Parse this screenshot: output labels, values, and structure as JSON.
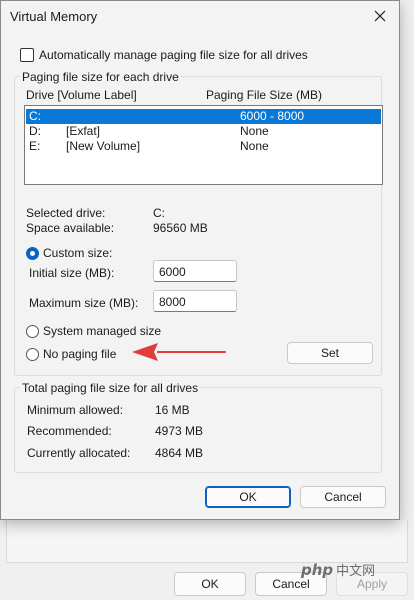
{
  "dialog": {
    "title": "Virtual Memory",
    "auto_manage_label": "Automatically manage paging file size for all drives",
    "auto_manage_checked": false,
    "group_each_drive": "Paging file size for each drive",
    "columns": {
      "drive": "Drive  [Volume Label]",
      "size": "Paging File Size (MB)"
    },
    "drives": [
      {
        "letter": "C:",
        "label": "",
        "size": "6000 - 8000",
        "selected": true
      },
      {
        "letter": "D:",
        "label": "[Exfat]",
        "size": "None",
        "selected": false
      },
      {
        "letter": "E:",
        "label": "[New Volume]",
        "size": "None",
        "selected": false
      }
    ],
    "selected_drive_label": "Selected drive:",
    "selected_drive_value": "C:",
    "space_available_label": "Space available:",
    "space_available_value": "96560 MB",
    "custom_size_label": "Custom size:",
    "initial_size_label": "Initial size (MB):",
    "initial_size_value": "6000",
    "maximum_size_label": "Maximum size (MB):",
    "maximum_size_value": "8000",
    "system_managed_label": "System managed size",
    "no_paging_label": "No paging file",
    "selected_option": "custom",
    "set_label": "Set",
    "group_total": "Total paging file size for all drives",
    "minimum_label": "Minimum allowed:",
    "minimum_value": "16 MB",
    "recommended_label": "Recommended:",
    "recommended_value": "4973 MB",
    "allocated_label": "Currently allocated:",
    "allocated_value": "4864 MB",
    "ok_label": "OK",
    "cancel_label": "Cancel"
  },
  "background": {
    "ok_label": "OK",
    "cancel_label": "Cancel",
    "apply_label": "Apply"
  },
  "watermark": {
    "logo": "php",
    "site": "中文网"
  },
  "annotation": {
    "arrow_color": "#e23b3b"
  },
  "colors": {
    "selection": "#0a78d7",
    "accent": "#0a63c4"
  }
}
